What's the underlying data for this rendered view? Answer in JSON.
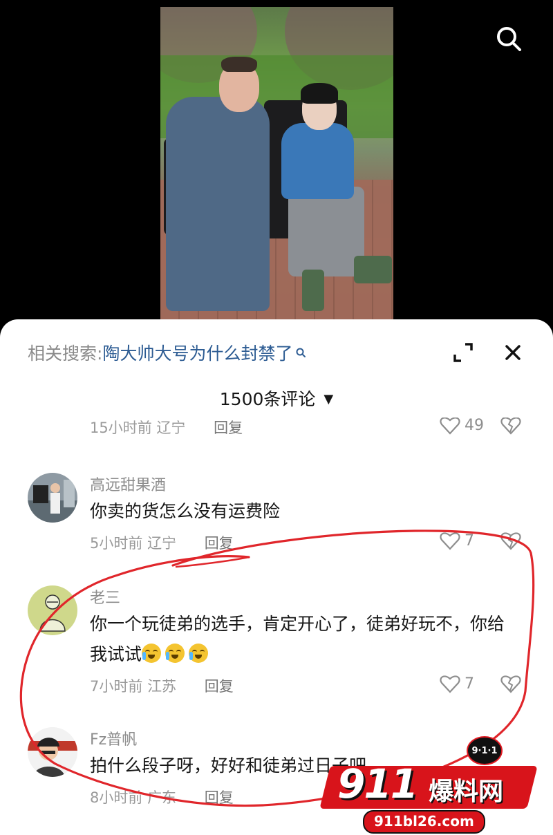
{
  "video": {
    "search_icon": "search-icon"
  },
  "sheet": {
    "related_label": "相关搜索:",
    "related_term": "陶大帅大号为什么封禁了",
    "comment_count": "1500条评论",
    "partial_row": {
      "time": "15小时前",
      "location": "辽宁",
      "reply": "回复",
      "likes": "49"
    },
    "comments": [
      {
        "username": "高远甜果酒",
        "text": "你卖的货怎么没有运费险",
        "time": "5小时前",
        "location": "辽宁",
        "reply": "回复",
        "likes": "7"
      },
      {
        "username": "老三",
        "text": "你一个玩徒弟的选手，肯定开心了，徒弟好玩不，你给我试试",
        "time": "7小时前",
        "location": "江苏",
        "reply": "回复",
        "likes": "7"
      },
      {
        "username": "Fz普帆",
        "text": "拍什么段子呀，好好和徒弟过日子吧",
        "time": "8小时前",
        "location": "广东",
        "reply": "回复"
      }
    ]
  },
  "watermark": {
    "badge": "9·1·1",
    "number": "911",
    "name": "爆料网",
    "url": "911bl26.com"
  },
  "colors": {
    "annotation_red": "#e0262b",
    "link_blue": "#2d5c93",
    "watermark_red": "#d8141b"
  }
}
